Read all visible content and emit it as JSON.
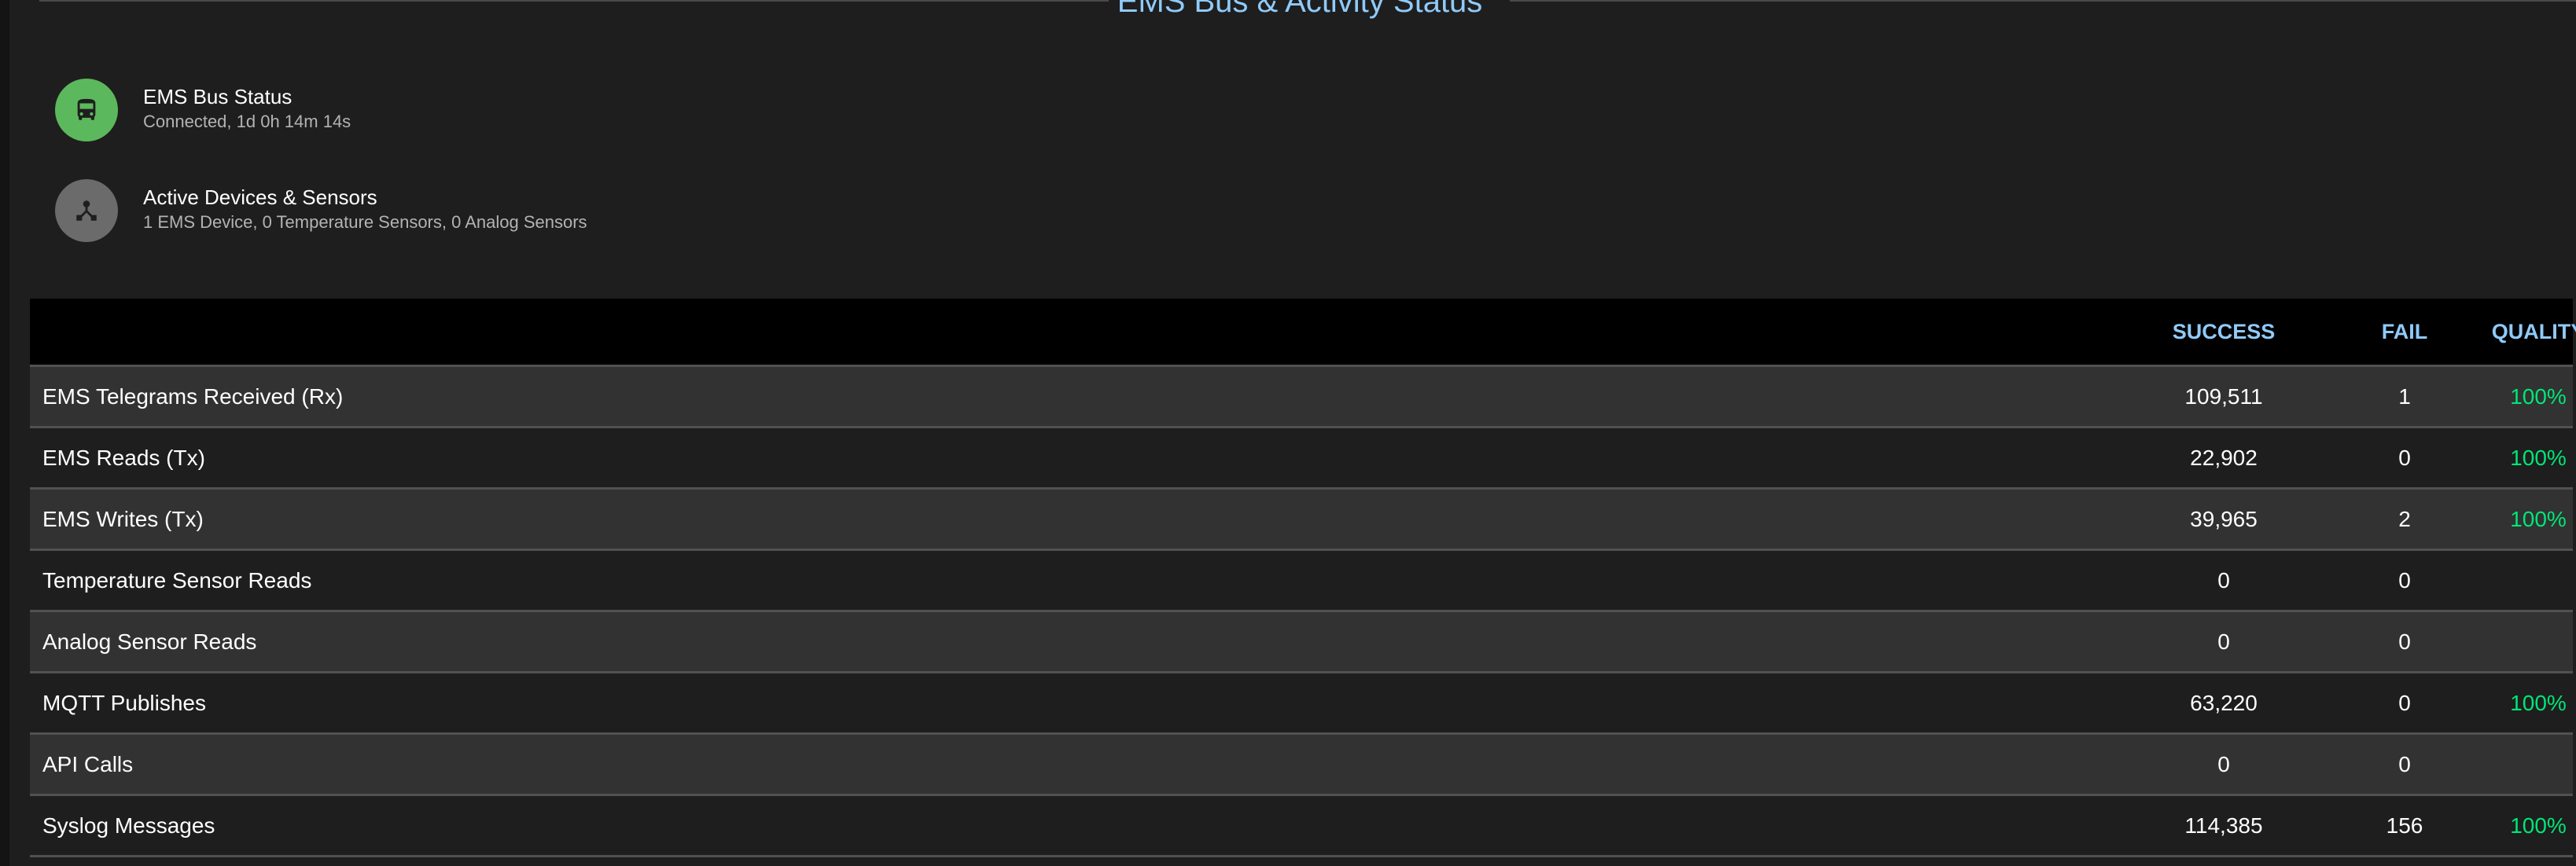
{
  "section": {
    "title": "EMS Bus & Activity Status"
  },
  "status_items": [
    {
      "icon": "bus-icon",
      "icon_bg": "#5cb85c",
      "primary": "EMS Bus Status",
      "secondary": "Connected, 1d 0h 14m 14s"
    },
    {
      "icon": "devices-tree-icon",
      "icon_bg": "#6b6b6b",
      "primary": "Active Devices & Sensors",
      "secondary": "1 EMS Device, 0 Temperature Sensors, 0 Analog Sensors"
    }
  ],
  "table": {
    "columns": {
      "success": "SUCCESS",
      "fail": "FAIL",
      "quality": "QUALITY"
    },
    "rows": [
      {
        "label": "EMS Telegrams Received (Rx)",
        "success": "109,511",
        "fail": "1",
        "quality": "100%"
      },
      {
        "label": "EMS Reads (Tx)",
        "success": "22,902",
        "fail": "0",
        "quality": "100%"
      },
      {
        "label": "EMS Writes (Tx)",
        "success": "39,965",
        "fail": "2",
        "quality": "100%"
      },
      {
        "label": "Temperature Sensor Reads",
        "success": "0",
        "fail": "0",
        "quality": ""
      },
      {
        "label": "Analog Sensor Reads",
        "success": "0",
        "fail": "0",
        "quality": ""
      },
      {
        "label": "MQTT Publishes",
        "success": "63,220",
        "fail": "0",
        "quality": "100%"
      },
      {
        "label": "API Calls",
        "success": "0",
        "fail": "0",
        "quality": ""
      },
      {
        "label": "Syslog Messages",
        "success": "114,385",
        "fail": "156",
        "quality": "100%"
      }
    ]
  },
  "colors": {
    "accent": "#90caf9",
    "quality_good": "#00e676",
    "background": "#1e1e1e",
    "header_bg": "#000000"
  }
}
